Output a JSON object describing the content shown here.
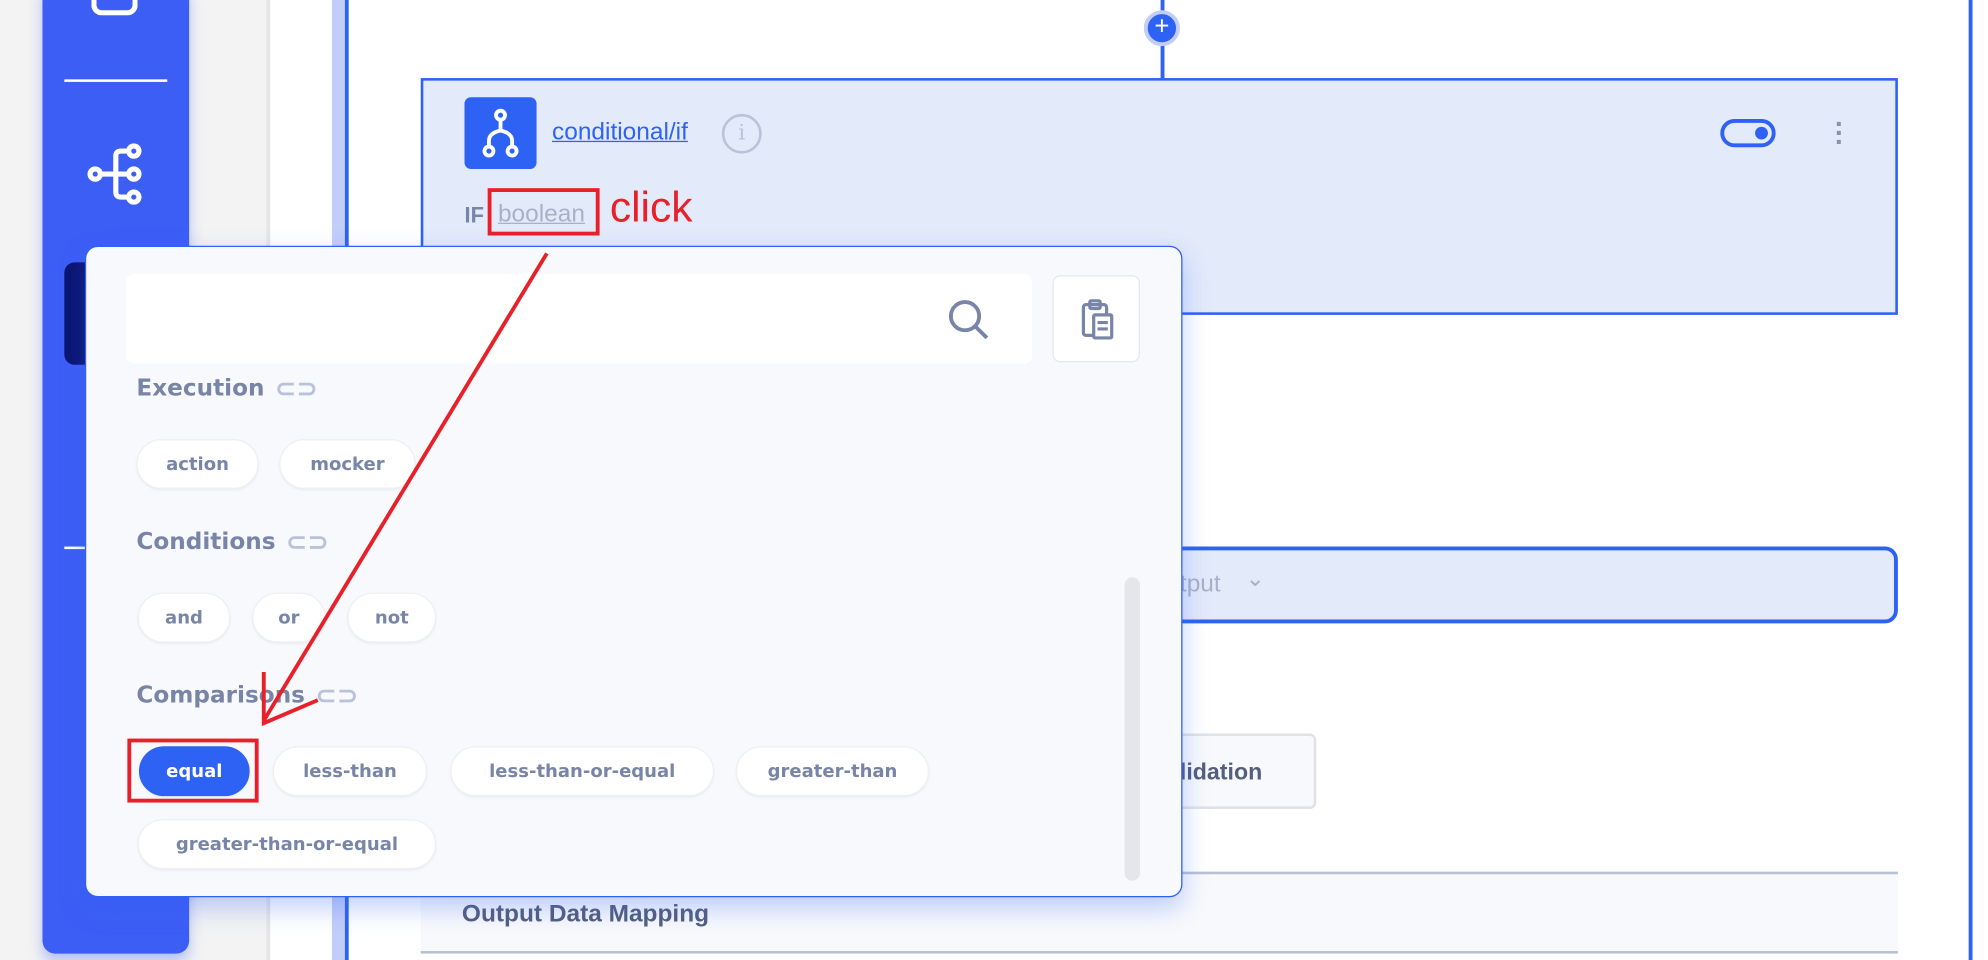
{
  "node": {
    "title": "conditional/if",
    "if_keyword": "IF",
    "condition_placeholder": "boolean"
  },
  "background": {
    "output_select_label": "tput",
    "validation_button": "lidation",
    "output_mapping_header": "Output Data Mapping"
  },
  "popup": {
    "search_placeholder": "",
    "sections": [
      {
        "title": "Execution",
        "items": [
          "action",
          "mocker"
        ]
      },
      {
        "title": "Conditions",
        "items": [
          "and",
          "or",
          "not"
        ]
      },
      {
        "title": "Comparisons",
        "items": [
          "equal",
          "less-than",
          "less-than-or-equal",
          "greater-than",
          "greater-than-or-equal"
        ],
        "selected": "equal"
      }
    ]
  },
  "annotation": {
    "click_label": "click"
  },
  "colors": {
    "accent": "#2e62f5",
    "sidebar": "#3d5ef5",
    "card_bg": "#e3eafa",
    "text_muted": "#7885a6",
    "annotation": "#e8202a"
  }
}
